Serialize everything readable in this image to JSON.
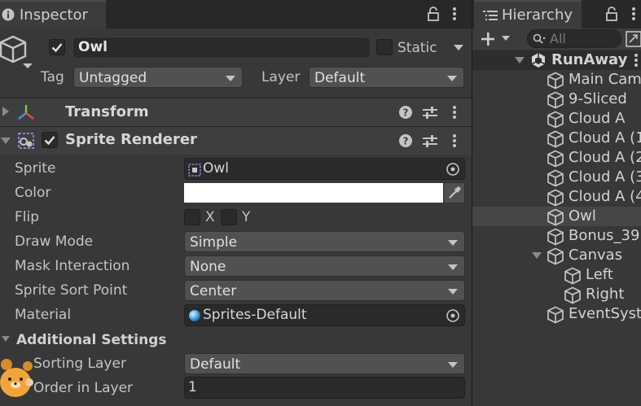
{
  "inspector": {
    "tab_title": "Inspector",
    "object": {
      "name": "Owl",
      "active": true,
      "static_label": "Static",
      "tag_label": "Tag",
      "tag_value": "Untagged",
      "layer_label": "Layer",
      "layer_value": "Default"
    },
    "components": [
      {
        "name": "Transform",
        "expanded": false
      },
      {
        "name": "Sprite Renderer",
        "expanded": true,
        "enabled": true
      }
    ],
    "sprite_renderer": {
      "sprite_label": "Sprite",
      "sprite_value": "Owl",
      "color_label": "Color",
      "color_value": "#FFFFFF",
      "flip_label": "Flip",
      "flip_x": "X",
      "flip_y": "Y",
      "draw_mode_label": "Draw Mode",
      "draw_mode_value": "Simple",
      "mask_label": "Mask Interaction",
      "mask_value": "None",
      "sort_point_label": "Sprite Sort Point",
      "sort_point_value": "Center",
      "material_label": "Material",
      "material_value": "Sprites-Default",
      "additional_label": "Additional Settings",
      "sorting_layer_label": "Sorting Layer",
      "sorting_layer_value": "Default",
      "order_label": "Order in Layer",
      "order_value": "1"
    }
  },
  "hierarchy": {
    "tab_title": "Hierarchy",
    "search_placeholder": "All",
    "scene": "RunAway",
    "items": [
      "Main Cam",
      "9-Sliced",
      "Cloud A",
      "Cloud A (1",
      "Cloud A (2",
      "Cloud A (3",
      "Cloud A (4",
      "Owl",
      "Bonus_39",
      "Canvas",
      "Left",
      "Right",
      "EventSyst"
    ],
    "selected": "Owl"
  },
  "colors": {
    "panel_bg": "#383838",
    "tab_bg": "#282828",
    "field_bg": "#2a2a2a",
    "dropdown_bg": "#515151",
    "selected_row": "#464646",
    "text": "#c4c4c4"
  }
}
